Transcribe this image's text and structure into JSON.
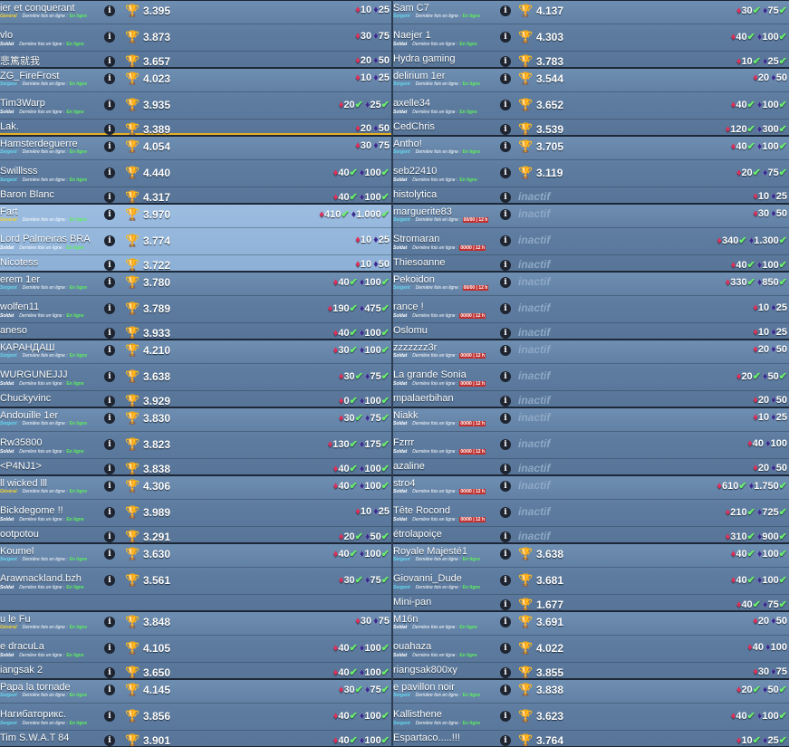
{
  "labels": {
    "seen": "Dernière fois en ligne :",
    "seen_value": "En ligne",
    "seen_old": "00/00 | 12 h",
    "inactive": "inactif",
    "info_glyph": "i"
  },
  "icons": {
    "info": "info-icon",
    "trophy": "trophy-icon",
    "ruby": "ruby-icon",
    "gem": "gem-icon",
    "check": "check-icon"
  },
  "colors": {
    "row": "#5d7ca0",
    "highlight": "#8db0d6",
    "general": "#f0d030",
    "sergent": "#66d8f0",
    "online": "#5ef05e",
    "trophy": "#f4b820"
  },
  "left": [
    {
      "hl": false,
      "rows": [
        {
          "name": "ier et conquerant",
          "rank": "Général",
          "rc": "gen",
          "score": "3.395",
          "r": "10",
          "g": "25",
          "check": false
        },
        {
          "name": "vlo",
          "rank": "Soldat",
          "rc": "sol",
          "score": "3.873",
          "r": "30",
          "g": "75",
          "check": false
        },
        {
          "name": "悲篤就我",
          "rank": "",
          "rc": "sol",
          "score": "3.657",
          "r": "20",
          "g": "50",
          "check": false
        }
      ]
    },
    {
      "hl": false,
      "rows": [
        {
          "name": "ZG_FireFrost",
          "rank": "Sergent",
          "rc": "ser",
          "score": "4.023",
          "r": "10",
          "g": "25",
          "check": false
        },
        {
          "name": "Tim3Warp",
          "rank": "Soldat",
          "rc": "sol",
          "score": "3.935",
          "r": "20",
          "g": "25",
          "check": true
        },
        {
          "name": "Lak.",
          "rank": "",
          "rc": "sol",
          "score": "3.389",
          "r": "20",
          "g": "50",
          "check": false
        }
      ]
    },
    {
      "hl": false,
      "rows": [
        {
          "name": "Hamsterdeguerre",
          "rank": "Sergent",
          "rc": "ser",
          "score": "4.054",
          "r": "30",
          "g": "75",
          "check": false
        },
        {
          "name": "Swilllsss",
          "rank": "Sergent",
          "rc": "ser",
          "score": "4.440",
          "r": "40",
          "g": "100",
          "check": true
        },
        {
          "name": "Baron Blanc",
          "rank": "",
          "rc": "sol",
          "score": "4.317",
          "r": "40",
          "g": "100",
          "check": true
        }
      ]
    },
    {
      "hl": true,
      "rows": [
        {
          "name": "Fart",
          "rank": "Général",
          "rc": "gen",
          "score": "3.970",
          "r": "410",
          "g": "1.000",
          "check": true
        },
        {
          "name": "Lord Palmeiras BRA",
          "rank": "Soldat",
          "rc": "sol",
          "score": "3.774",
          "r": "10",
          "g": "25",
          "check": false
        },
        {
          "name": "Nicotess",
          "rank": "",
          "rc": "sol",
          "score": "3.722",
          "r": "10",
          "g": "50",
          "check": false
        }
      ]
    },
    {
      "hl": false,
      "rows": [
        {
          "name": "erem 1er",
          "rank": "Sergent",
          "rc": "ser",
          "score": "3.780",
          "r": "40",
          "g": "100",
          "check": true
        },
        {
          "name": "wolfen11",
          "rank": "Soldat",
          "rc": "sol",
          "score": "3.789",
          "r": "190",
          "g": "475",
          "check": true
        },
        {
          "name": "aneso",
          "rank": "",
          "rc": "sol",
          "score": "3.933",
          "r": "40",
          "g": "100",
          "check": true
        }
      ]
    },
    {
      "hl": false,
      "rows": [
        {
          "name": "КАРАНДАШ",
          "rank": "Sergent",
          "rc": "ser",
          "score": "4.210",
          "r": "30",
          "g": "100",
          "check": true
        },
        {
          "name": "WURGUNEJJJ",
          "rank": "Soldat",
          "rc": "sol",
          "score": "3.638",
          "r": "30",
          "g": "75",
          "check": true
        },
        {
          "name": "Chuckyvinc",
          "rank": "",
          "rc": "sol",
          "score": "3.929",
          "r": "0",
          "g": "100",
          "check": true
        }
      ]
    },
    {
      "hl": false,
      "rows": [
        {
          "name": "Andouille 1er",
          "rank": "Sergent",
          "rc": "ser",
          "score": "3.830",
          "r": "30",
          "g": "75",
          "check": true
        },
        {
          "name": "Rw35800",
          "rank": "Soldat",
          "rc": "sol",
          "score": "3.823",
          "r": "130",
          "g": "175",
          "check": true
        },
        {
          "name": "<P4NJ1>",
          "rank": "",
          "rc": "sol",
          "score": "3.838",
          "r": "40",
          "g": "100",
          "check": true
        }
      ]
    },
    {
      "hl": false,
      "rows": [
        {
          "name": "ll wicked lll",
          "rank": "Général",
          "rc": "gen",
          "score": "4.306",
          "r": "40",
          "g": "100",
          "check": true
        },
        {
          "name": "Bickdegome !!",
          "rank": "Soldat",
          "rc": "sol",
          "score": "3.989",
          "r": "10",
          "g": "25",
          "check": false
        },
        {
          "name": "ootpotou",
          "rank": "",
          "rc": "sol",
          "score": "3.291",
          "r": "20",
          "g": "50",
          "check": true
        }
      ]
    },
    {
      "hl": false,
      "rows": [
        {
          "name": "Koumel",
          "rank": "Sergent",
          "rc": "ser",
          "score": "3.630",
          "r": "40",
          "g": "100",
          "check": true
        },
        {
          "name": "Arawnackland.bzh",
          "rank": "Soldat",
          "rc": "sol",
          "score": "3.561",
          "r": "30",
          "g": "75",
          "check": true
        },
        {
          "name": "",
          "rank": "",
          "rc": "sol",
          "score": "",
          "r": "",
          "g": "",
          "check": false
        }
      ]
    },
    {
      "hl": false,
      "rows": [
        {
          "name": "u le Fu",
          "rank": "Général",
          "rc": "gen",
          "score": "3.848",
          "r": "30",
          "g": "75",
          "check": false
        },
        {
          "name": "e dracuLa",
          "rank": "Soldat",
          "rc": "sol",
          "score": "4.105",
          "r": "40",
          "g": "100",
          "check": true
        },
        {
          "name": "iangsak 2",
          "rank": "",
          "rc": "sol",
          "score": "3.650",
          "r": "40",
          "g": "100",
          "check": true
        }
      ]
    },
    {
      "hl": false,
      "rows": [
        {
          "name": "Papa la tornade",
          "rank": "Sergent",
          "rc": "ser",
          "score": "4.145",
          "r": "30",
          "g": "75",
          "check": true
        },
        {
          "name": "Нагибаторикс.",
          "rank": "Sergent",
          "rc": "ser",
          "score": "3.856",
          "r": "40",
          "g": "100",
          "check": true
        },
        {
          "name": "Tim S.W.A.T 84",
          "rank": "",
          "rc": "sol",
          "score": "3.901",
          "r": "40",
          "g": "100",
          "check": true
        }
      ]
    }
  ],
  "right": [
    {
      "hl": false,
      "rows": [
        {
          "name": "Sam C7",
          "rank": "Sergent",
          "rc": "ser",
          "score": "4.137",
          "r": "30",
          "g": "75",
          "check": true
        },
        {
          "name": "Naejer 1",
          "rank": "Soldat",
          "rc": "sol",
          "score": "4.303",
          "r": "40",
          "g": "100",
          "check": true
        },
        {
          "name": "Hydra gaming",
          "rank": "",
          "rc": "sol",
          "score": "3.783",
          "r": "10",
          "g": "25",
          "check": true
        }
      ]
    },
    {
      "hl": false,
      "rows": [
        {
          "name": "delirium 1er",
          "rank": "Sergent",
          "rc": "ser",
          "score": "3.544",
          "r": "20",
          "g": "50",
          "check": false
        },
        {
          "name": "axelle34",
          "rank": "Soldat",
          "rc": "sol",
          "score": "3.652",
          "r": "40",
          "g": "100",
          "check": true
        },
        {
          "name": "CedChris",
          "rank": "",
          "rc": "sol",
          "score": "3.539",
          "r": "120",
          "g": "300",
          "check": true
        }
      ]
    },
    {
      "hl": false,
      "rows": [
        {
          "name": "Antho!",
          "rank": "Sergent",
          "rc": "ser",
          "score": "3.705",
          "r": "40",
          "g": "100",
          "check": true
        },
        {
          "name": "seb22410",
          "rank": "Soldat",
          "rc": "sol",
          "score": "3.119",
          "r": "20",
          "g": "75",
          "check": true
        },
        {
          "name": "histolytica",
          "rank": "",
          "rc": "sol",
          "score": "",
          "inactive": true,
          "r": "10",
          "g": "25",
          "check": false
        }
      ]
    },
    {
      "hl": false,
      "rows": [
        {
          "name": "marguerite83",
          "rank": "Sergent",
          "rc": "ser",
          "old": true,
          "score": "",
          "inactive": true,
          "r": "30",
          "g": "50",
          "check": false
        },
        {
          "name": "Stromaran",
          "rank": "Soldat",
          "rc": "sol",
          "old": true,
          "score": "",
          "inactive": true,
          "r": "340",
          "g": "1.300",
          "check": true
        },
        {
          "name": "Thiesoanne",
          "rank": "",
          "rc": "sol",
          "score": "",
          "inactive": true,
          "r": "40",
          "g": "100",
          "check": true
        }
      ]
    },
    {
      "hl": false,
      "rows": [
        {
          "name": "Pekoidon",
          "rank": "Sergent",
          "rc": "ser",
          "old": true,
          "score": "",
          "inactive": true,
          "r": "330",
          "g": "850",
          "check": true
        },
        {
          "name": "rance !",
          "rank": "Soldat",
          "rc": "sol",
          "old": true,
          "score": "",
          "inactive": true,
          "r": "10",
          "g": "25",
          "check": false
        },
        {
          "name": "Oslomu",
          "rank": "",
          "rc": "sol",
          "score": "",
          "inactive": true,
          "r": "10",
          "g": "25",
          "check": false
        }
      ]
    },
    {
      "hl": false,
      "rows": [
        {
          "name": "zzzzzzz3r",
          "rank": "Soldat",
          "rc": "sol",
          "old": true,
          "score": "",
          "inactive": true,
          "r": "20",
          "g": "50",
          "check": false
        },
        {
          "name": "La grande Sonia",
          "rank": "Soldat",
          "rc": "sol",
          "old": true,
          "score": "",
          "inactive": true,
          "r": "20",
          "g": "50",
          "check": true
        },
        {
          "name": "mpalaerbihan",
          "rank": "",
          "rc": "sol",
          "score": "",
          "inactive": true,
          "r": "20",
          "g": "50",
          "check": false
        }
      ]
    },
    {
      "hl": false,
      "rows": [
        {
          "name": "Niakk",
          "rank": "Soldat",
          "rc": "sol",
          "old": true,
          "score": "",
          "inactive": true,
          "r": "10",
          "g": "25",
          "check": false
        },
        {
          "name": "Fzrrr",
          "rank": "Soldat",
          "rc": "sol",
          "old": true,
          "score": "",
          "inactive": true,
          "r": "40",
          "g": "100",
          "check": false
        },
        {
          "name": "azaline",
          "rank": "",
          "rc": "sol",
          "score": "",
          "inactive": true,
          "r": "20",
          "g": "50",
          "check": false
        }
      ]
    },
    {
      "hl": false,
      "rows": [
        {
          "name": "stro4",
          "rank": "Soldat",
          "rc": "sol",
          "old": true,
          "score": "",
          "inactive": true,
          "r": "610",
          "g": "1.750",
          "check": true
        },
        {
          "name": "Tête Rocond",
          "rank": "Soldat",
          "rc": "sol",
          "old": true,
          "score": "",
          "inactive": true,
          "r": "210",
          "g": "725",
          "check": true
        },
        {
          "name": "étrolapoiçe",
          "rank": "",
          "rc": "sol",
          "score": "",
          "inactive": true,
          "r": "310",
          "g": "900",
          "check": true
        }
      ]
    },
    {
      "hl": false,
      "rows": [
        {
          "name": "Royale Majesté1",
          "rank": "Sergent",
          "rc": "ser",
          "score": "3.638",
          "r": "40",
          "g": "100",
          "check": true
        },
        {
          "name": "Giovanni_Dude",
          "rank": "Sergent",
          "rc": "ser",
          "score": "3.681",
          "r": "40",
          "g": "100",
          "check": true
        },
        {
          "name": "Mini-pan",
          "rank": "",
          "rc": "sol",
          "score": "1.677",
          "r": "40",
          "g": "75",
          "check": true
        }
      ]
    },
    {
      "hl": false,
      "rows": [
        {
          "name": "M16n",
          "rank": "Soldat",
          "rc": "sol",
          "score": "3.691",
          "r": "20",
          "g": "50",
          "check": false
        },
        {
          "name": "ouahaza",
          "rank": "Soldat",
          "rc": "sol",
          "score": "4.022",
          "r": "40",
          "g": "100",
          "check": false
        },
        {
          "name": "riangsak800xy",
          "rank": "",
          "rc": "sol",
          "score": "3.855",
          "r": "30",
          "g": "75",
          "check": false
        }
      ]
    },
    {
      "hl": false,
      "rows": [
        {
          "name": "e pavillon noir",
          "rank": "Sergent",
          "rc": "ser",
          "score": "3.838",
          "r": "20",
          "g": "50",
          "check": true
        },
        {
          "name": "Kallisthene",
          "rank": "Sergent",
          "rc": "ser",
          "score": "3.623",
          "r": "40",
          "g": "100",
          "check": true
        },
        {
          "name": "Espartaco.....!!!",
          "rank": "",
          "rc": "sol",
          "score": "3.764",
          "r": "10",
          "g": "25",
          "check": true
        }
      ]
    }
  ]
}
